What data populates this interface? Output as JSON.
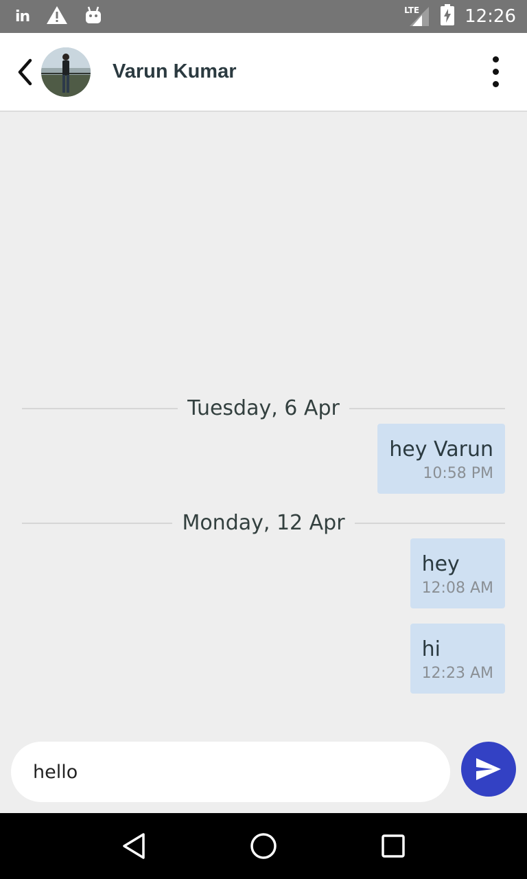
{
  "status_bar": {
    "time": "12:26",
    "network_label": "LTE",
    "linkedin_glyph": "in",
    "icons": [
      "linkedin-icon",
      "warning-icon",
      "android-icon",
      "lte-signal-icon",
      "battery-charging-icon"
    ]
  },
  "header": {
    "contact_name": "Varun Kumar",
    "icons": [
      "back-arrow-icon",
      "avatar",
      "overflow-menu-icon"
    ]
  },
  "conversation": {
    "groups": [
      {
        "date": "Tuesday, 6 Apr",
        "messages": [
          {
            "text": "hey Varun",
            "time": "10:58 PM"
          }
        ]
      },
      {
        "date": "Monday, 12 Apr",
        "messages": [
          {
            "text": "hey",
            "time": "12:08 AM"
          },
          {
            "text": "hi",
            "time": "12:23 AM"
          }
        ]
      }
    ]
  },
  "composer": {
    "value": "hello",
    "send_icon": "send-icon"
  },
  "colors": {
    "status_bar": "#757575",
    "background": "#eeeeee",
    "bubble": "#cfe0f2",
    "send_button": "#3341c4",
    "nav_bar": "#000000"
  },
  "nav_bar": {
    "icons": [
      "back-triangle-icon",
      "home-circle-icon",
      "recents-square-icon"
    ]
  }
}
